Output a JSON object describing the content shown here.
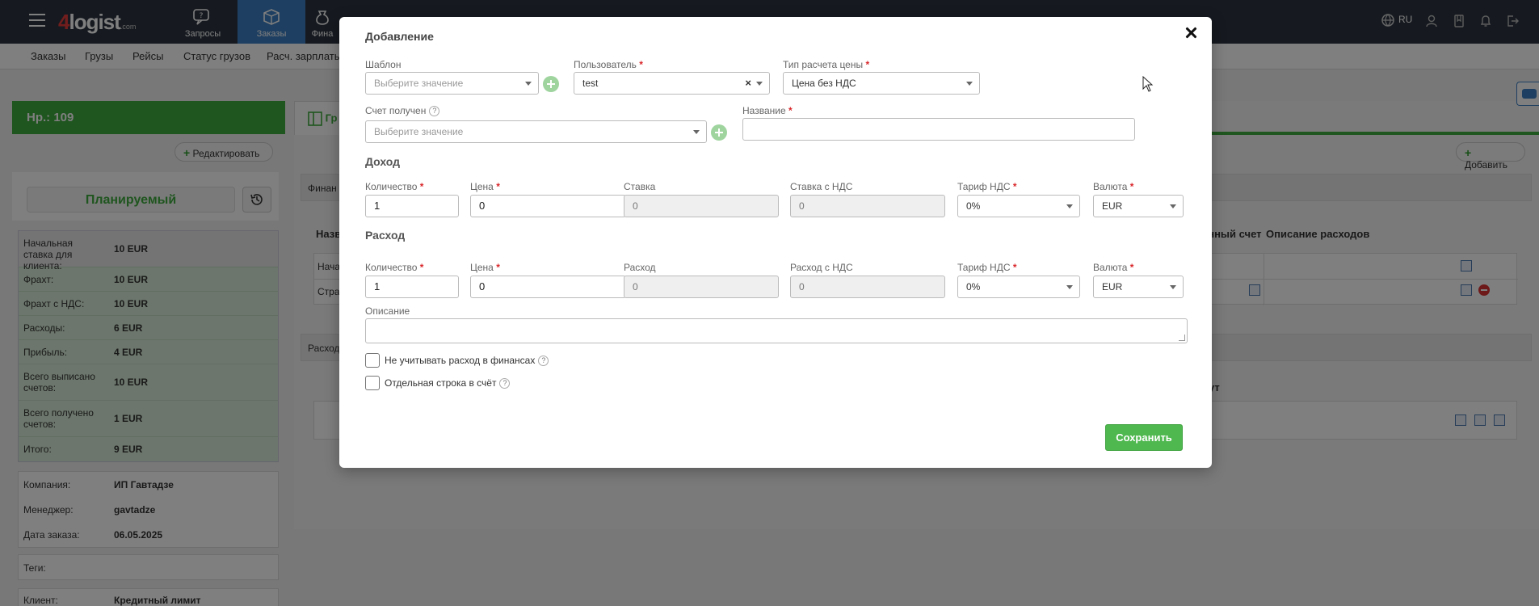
{
  "topbar": {
    "logo_number": "4",
    "logo_text": "logist",
    "logo_suffix": ".com",
    "nav": [
      {
        "label": "Запросы",
        "icon": "chat-question-icon"
      },
      {
        "label": "Заказы",
        "icon": "package-icon"
      },
      {
        "label": "Фина",
        "icon": "money-bag-icon"
      }
    ],
    "lang": "RU"
  },
  "subnav": [
    "Заказы",
    "Грузы",
    "Рейсы",
    "Статус грузов",
    "Расч. зарплаты"
  ],
  "left": {
    "order_number": "Нр.: 109",
    "edit_label": "Редактировать",
    "status": "Планируемый",
    "finance": [
      {
        "k": "Начальная ставка для клиента:",
        "v": "10 EUR"
      },
      {
        "k": "Фрахт:",
        "v": "10 EUR"
      },
      {
        "k": "Фрахт с НДС:",
        "v": "10 EUR"
      },
      {
        "k": "Расходы:",
        "v": "6 EUR"
      },
      {
        "k": "Прибыль:",
        "v": "4 EUR"
      },
      {
        "k": "Всего выписано счетов:",
        "v": "10 EUR"
      },
      {
        "k": "Всего получено счетов:",
        "v": "1 EUR"
      },
      {
        "k": "Итого:",
        "v": "9 EUR"
      }
    ],
    "info": [
      {
        "k": "Компания:",
        "v": "ИП Гавтадзе"
      },
      {
        "k": "Менеджер:",
        "v": "gavtadze"
      },
      {
        "k": "Дата заказа:",
        "v": "06.05.2025"
      }
    ],
    "tags_label": "Теги:",
    "client_label": "Клиент:",
    "client_value": "Кредитный лимит"
  },
  "right": {
    "tab_label": "Гр",
    "add_label": "Добавить",
    "section1": "Финан",
    "col_name": "Назв",
    "col_invoice": "анный счет",
    "col_expense_desc": "Описание расходов",
    "row1": "Нача",
    "row2": "Стра",
    "section2": "Расход",
    "col_currency": "ут"
  },
  "modal": {
    "title": "Добавление",
    "template_label": "Шаблон",
    "template_placeholder": "Выберите значение",
    "user_label": "Пользователь",
    "user_value": "test",
    "price_type_label": "Тип расчета цены",
    "price_type_value": "Цена без НДС",
    "invoice_label": "Счет получен",
    "invoice_placeholder": "Выберите значение",
    "name_label": "Название",
    "name_value": "",
    "income": {
      "title": "Доход",
      "qty_label": "Количество",
      "qty": "1",
      "price_label": "Цена",
      "price": "0",
      "rate_label": "Ставка",
      "rate": "0",
      "rate_vat_label": "Ставка с НДС",
      "rate_vat": "0",
      "vat_label": "Тариф НДС",
      "vat": "0%",
      "currency_label": "Валюта",
      "currency": "EUR"
    },
    "expense": {
      "title": "Расход",
      "qty_label": "Количество",
      "qty": "1",
      "price_label": "Цена",
      "price": "0",
      "cost_label": "Расход",
      "cost": "0",
      "cost_vat_label": "Расход с НДС",
      "cost_vat": "0",
      "vat_label": "Тариф НДС",
      "vat": "0%",
      "currency_label": "Валюта",
      "currency": "EUR"
    },
    "description_label": "Описание",
    "description_value": "",
    "chk_ignore_label": "Не учитывать расход в финансах",
    "chk_separate_label": "Отдельная строка в счёт",
    "required_mark": "*",
    "help_mark": "?",
    "clear_mark": "×",
    "save_label": "Сохранить"
  }
}
